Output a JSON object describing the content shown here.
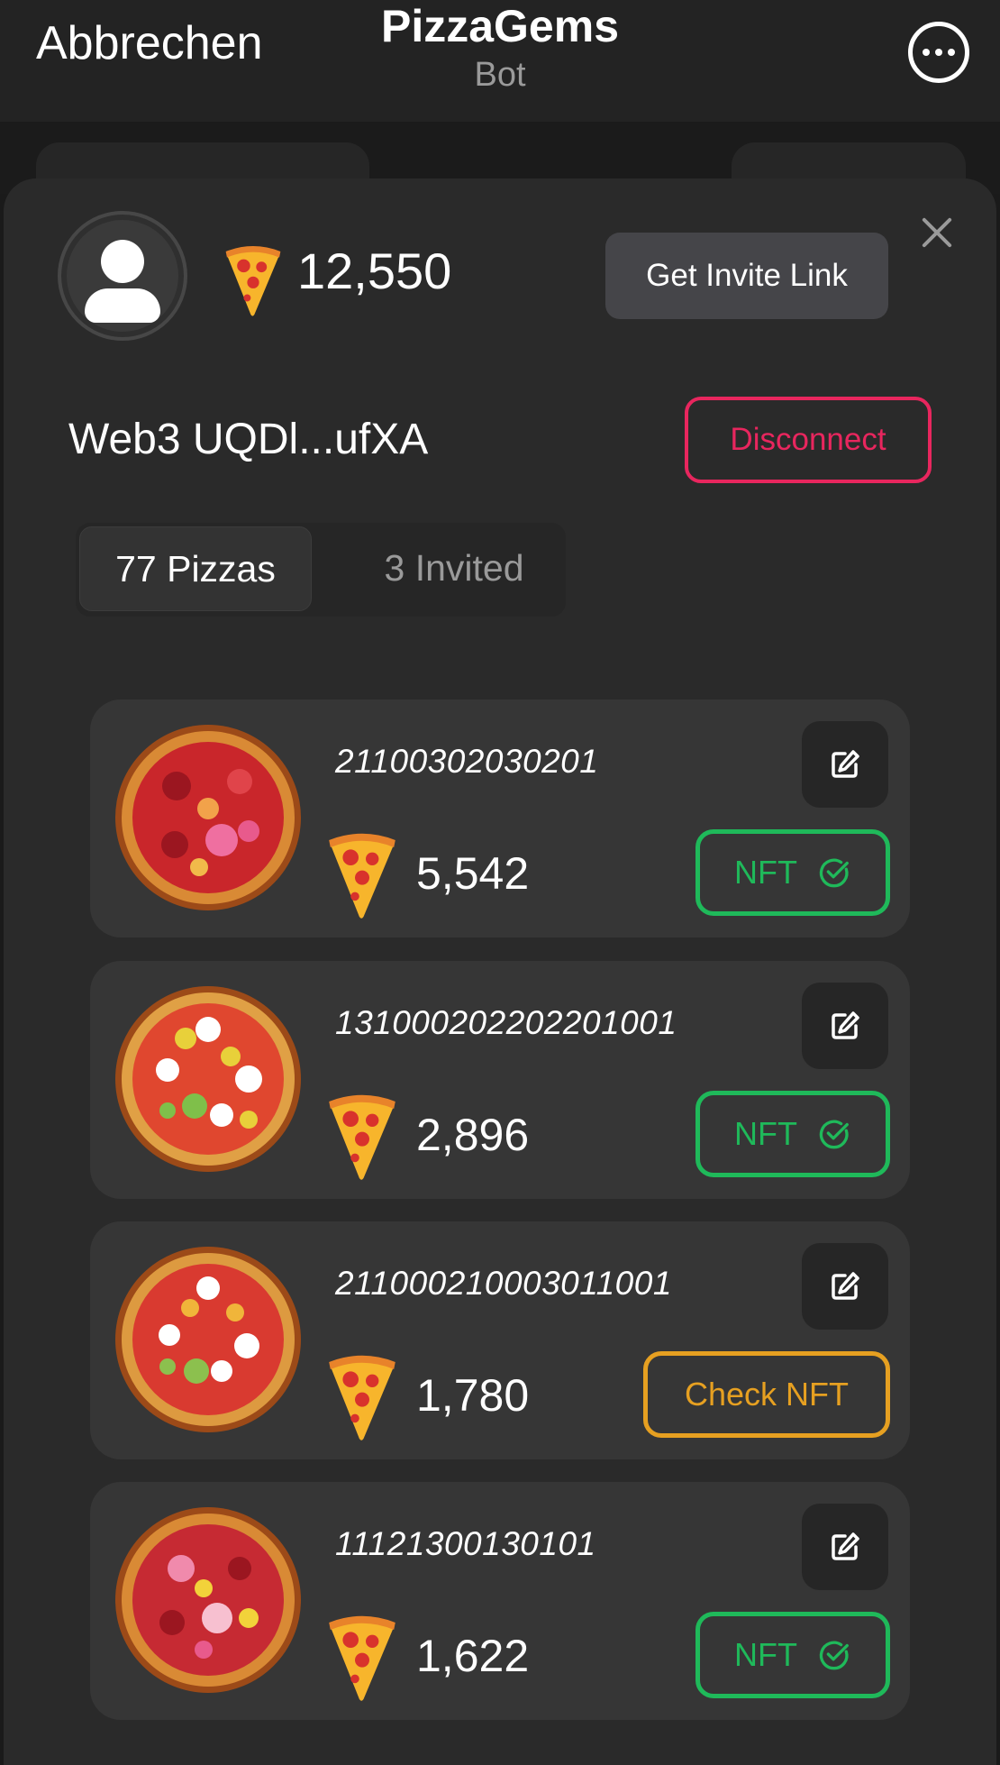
{
  "topbar": {
    "cancel_label": "Abbrechen",
    "title": "PizzaGems",
    "subtitle": "Bot"
  },
  "header": {
    "balance": "12,550",
    "invite_label": "Get Invite Link"
  },
  "wallet": {
    "label": "Web3 UQDl...ufXA",
    "disconnect_label": "Disconnect"
  },
  "tabs": [
    {
      "label": "77 Pizzas"
    },
    {
      "label": "3 Invited"
    }
  ],
  "pizzas": [
    {
      "id": "21100302030201",
      "score": "5,542",
      "action": "NFT"
    },
    {
      "id": "131000202202201001",
      "score": "2,896",
      "action": "NFT"
    },
    {
      "id": "211000210003011001",
      "score": "1,780",
      "action": "Check NFT"
    },
    {
      "id": "11121300130101",
      "score": "1,622",
      "action": "NFT"
    }
  ],
  "colors": {
    "nft_green": "#1fb95a",
    "check_orange": "#e6a021",
    "disconnect_red": "#e8265e"
  }
}
